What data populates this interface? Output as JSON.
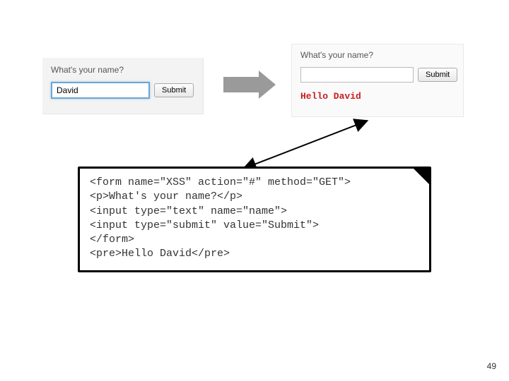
{
  "left_form": {
    "label": "What's your name?",
    "value": "David",
    "submit": "Submit"
  },
  "right_form": {
    "label": "What's your name?",
    "value": "",
    "submit": "Submit",
    "output": "Hello David"
  },
  "code": {
    "l1": "<form name=\"XSS\" action=\"#\" method=\"GET\">",
    "l2": "<p>What's your name?</p>",
    "l3": "<input type=\"text\" name=\"name\">",
    "l4": "<input type=\"submit\" value=\"Submit\">",
    "l5": "</form>",
    "l6": "<pre>Hello David</pre>"
  },
  "page_number": "49"
}
